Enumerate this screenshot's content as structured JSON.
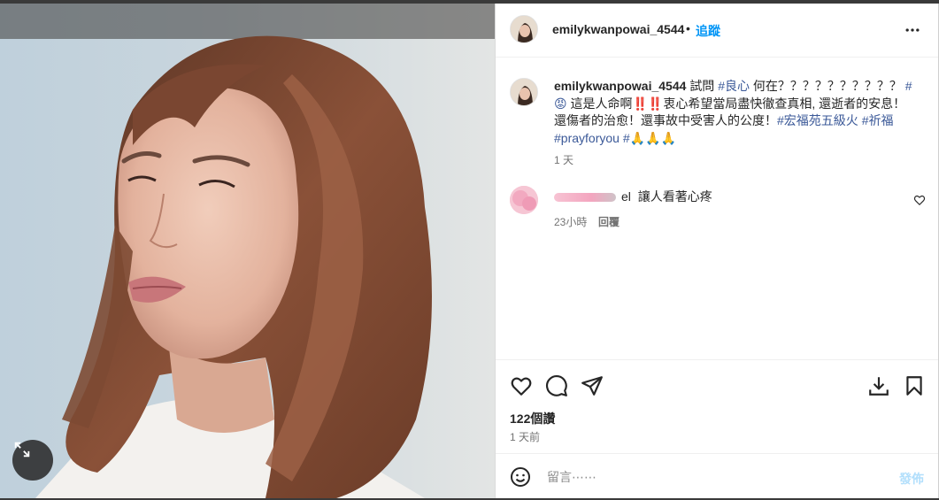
{
  "post": {
    "username": "emilykwanpowai_4544",
    "separator": "•",
    "follow_label": "追蹤",
    "caption_user": "emilykwanpowai_4544",
    "caption": {
      "p1": "試問",
      "tag1": "#良心",
      "p2": "何在？？？？？？？？？？",
      "tag2": "#😡",
      "p3": "這是人命啊‼️‼️衷心希望當局盡快徹查真相, 還逝者的安息！還傷者的治愈！還事故中受害人的公度！",
      "tag3": "#宏福苑五級火",
      "tag4": "#祈福",
      "tag5": "#prayforyou",
      "tag6": "#🙏🙏🙏"
    },
    "caption_time": "1 天"
  },
  "comment": {
    "user_suffix": "el",
    "text": "讓人看著心疼",
    "time": "23小時",
    "reply_label": "回覆"
  },
  "stats": {
    "likes": "122個讚",
    "time_ago": "1 天前"
  },
  "composer": {
    "placeholder": "留言⋯⋯",
    "post_label": "發佈"
  },
  "icons": {
    "more": "more-horizontal-icon",
    "like": "heart-icon",
    "comment": "comment-icon",
    "share": "send-icon",
    "download": "download-icon",
    "save": "bookmark-icon",
    "emoji": "emoji-icon",
    "expand": "expand-icon"
  },
  "colors": {
    "link_blue": "#0095f6",
    "hashtag": "#3b5998",
    "muted": "#737373"
  }
}
